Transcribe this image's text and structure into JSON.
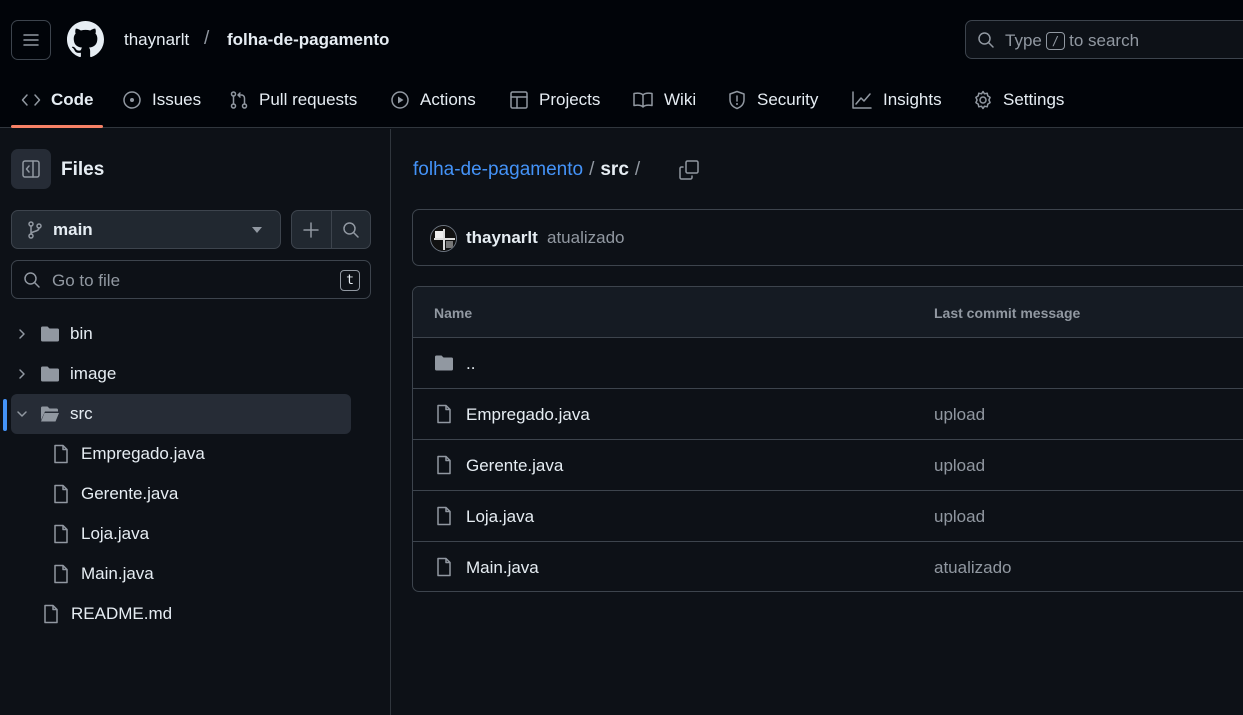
{
  "header": {
    "owner": "thaynarlt",
    "separator": "/",
    "repo": "folha-de-pagamento",
    "search": {
      "prefix": "Type",
      "key": "/",
      "suffix": "to search"
    }
  },
  "tabs": [
    {
      "label": "Code",
      "icon": "code-icon",
      "active": true
    },
    {
      "label": "Issues",
      "icon": "issue-icon"
    },
    {
      "label": "Pull requests",
      "icon": "pull-request-icon"
    },
    {
      "label": "Actions",
      "icon": "play-icon"
    },
    {
      "label": "Projects",
      "icon": "table-icon"
    },
    {
      "label": "Wiki",
      "icon": "book-icon"
    },
    {
      "label": "Security",
      "icon": "shield-icon"
    },
    {
      "label": "Insights",
      "icon": "graph-icon"
    },
    {
      "label": "Settings",
      "icon": "gear-icon"
    }
  ],
  "sidebar": {
    "title": "Files",
    "branch": "main",
    "goto_placeholder": "Go to file",
    "goto_shortcut": "t",
    "tree": [
      {
        "label": "bin",
        "type": "folder",
        "expanded": false
      },
      {
        "label": "image",
        "type": "folder",
        "expanded": false
      },
      {
        "label": "src",
        "type": "folder",
        "expanded": true,
        "selected": true
      },
      {
        "label": "Empregado.java",
        "type": "file"
      },
      {
        "label": "Gerente.java",
        "type": "file"
      },
      {
        "label": "Loja.java",
        "type": "file"
      },
      {
        "label": "Main.java",
        "type": "file"
      },
      {
        "label": "README.md",
        "type": "file"
      }
    ]
  },
  "main": {
    "breadcrumb": {
      "repo": "folha-de-pagamento",
      "sep": "/",
      "folder": "src",
      "trailing": "/"
    },
    "commit": {
      "author": "thaynarlt",
      "message": "atualizado"
    },
    "table": {
      "headers": {
        "name": "Name",
        "message": "Last commit message"
      },
      "parent": "..",
      "rows": [
        {
          "name": "Empregado.java",
          "message": "upload"
        },
        {
          "name": "Gerente.java",
          "message": "upload"
        },
        {
          "name": "Loja.java",
          "message": "upload"
        },
        {
          "name": "Main.java",
          "message": "atualizado"
        }
      ]
    }
  },
  "colors": {
    "accent": "#4493f8",
    "tab_underline": "#f78166",
    "background": "#0d1117",
    "header_bg": "#010409"
  }
}
